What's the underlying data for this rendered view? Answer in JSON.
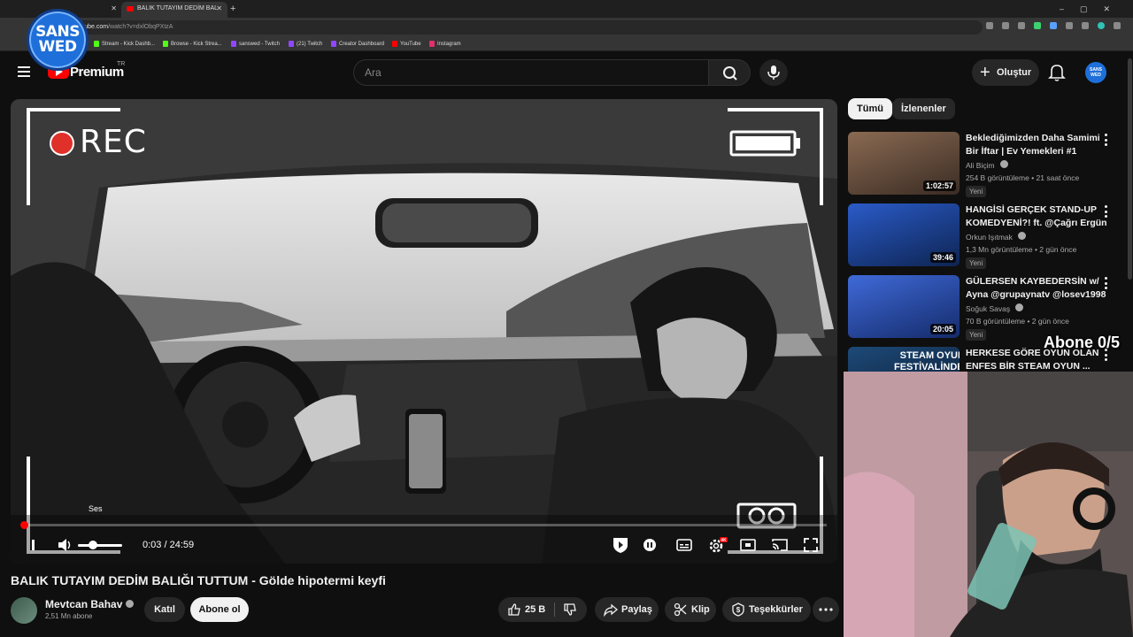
{
  "browser": {
    "tabs": [
      {
        "label": ""
      },
      {
        "label": "BALIK TUTAYIM DEDİM BAL"
      }
    ],
    "url_host": "youtube.com",
    "url_path": "/watch?v=dxlObqPXtzA",
    "bookmarks": [
      {
        "label": "Stream - Kick Dashb...",
        "color": "#53fc18"
      },
      {
        "label": "Browse - Kick Strea...",
        "color": "#53fc18"
      },
      {
        "label": "sanswed - Twitch",
        "color": "#9146ff"
      },
      {
        "label": "(21) Twitch",
        "color": "#9146ff"
      },
      {
        "label": "Creator Dashboard",
        "color": "#9146ff"
      },
      {
        "label": "YouTube",
        "color": "#ff0000"
      },
      {
        "label": "Instagram",
        "color": "#e1306c"
      }
    ]
  },
  "overlay": {
    "logo_line1": "SANS",
    "logo_line2": "WED",
    "sub_goal": "Abone 0/5"
  },
  "header": {
    "brand": "Premium",
    "country": "TR",
    "search_placeholder": "Ara",
    "create_label": "Oluştur",
    "avatar_text": "SANS WED"
  },
  "player": {
    "rec_text": "REC",
    "volume_tip": "Ses",
    "time_current": "0:03",
    "time_total": "24:59",
    "time_display": "0:03 / 24:59",
    "progress_fraction": 0.002,
    "volume_fraction": 0.3,
    "settings_badge": "4K"
  },
  "video": {
    "title": "BALIK TUTAYIM DEDİM BALIĞI TUTTUM - Gölde hipotermi keyfi",
    "channel": "Mevtcan Bahav",
    "subscribers": "2,51 Mn abone",
    "join_label": "Katıl",
    "subscribe_label": "Abone ol",
    "likes": "25 B",
    "share_label": "Paylaş",
    "clip_label": "Klip",
    "thanks_label": "Teşekkürler"
  },
  "sidebar": {
    "chips": [
      "Tümü",
      "İzlenenler"
    ],
    "items": [
      {
        "title": "Beklediğimizden Daha Samimi Bir İftar | Ev Yemekleri #1",
        "channel": "Ali Biçim",
        "meta": "254 B görüntüleme • 21 saat önce",
        "badge": "Yeni",
        "duration": "1:02:57",
        "thumb": "#6b4a3a"
      },
      {
        "title": "HANGİSİ GERÇEK STAND-UP KOMEDYENİ?! ft. @Çağrı Ergün",
        "channel": "Orkun Işıtmak",
        "meta": "1,3 Mn görüntüleme • 2 gün önce",
        "badge": "Yeni",
        "duration": "39:46",
        "thumb": "#1d3f8a"
      },
      {
        "title": "GÜLERSEN KAYBEDERSİN w/ Ayna @grupaynatv @losev1998",
        "channel": "Soğuk Savaş",
        "meta": "70 B görüntüleme • 2 gün önce",
        "badge": "Yeni",
        "duration": "20:05",
        "thumb": "#2a4fa8"
      },
      {
        "title": "HERKESE GÖRE OYUN OLAN ENFES BİR STEAM OYUN ...",
        "channel": "",
        "meta": "",
        "badge": "",
        "duration": "",
        "thumb": "#14324f",
        "thumb_text1": "STEAM OYUN",
        "thumb_text2": "FESTİVALİNDEN"
      }
    ]
  }
}
